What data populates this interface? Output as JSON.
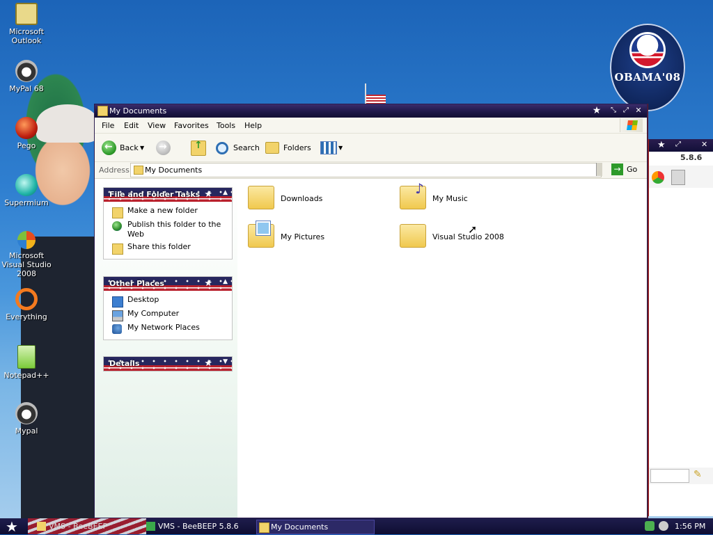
{
  "desktop": {
    "icons": [
      {
        "label": "Microsoft Outlook"
      },
      {
        "label": "MyPal 68"
      },
      {
        "label": "Pego"
      },
      {
        "label": "Supermium"
      },
      {
        "label": "Microsoft Visual Studio 2008"
      },
      {
        "label": "Everything"
      },
      {
        "label": "Notepad++"
      },
      {
        "label": "Mypal"
      }
    ],
    "badge": {
      "text": "OBAMA'08"
    }
  },
  "bg_window": {
    "version": "5.8.6"
  },
  "window": {
    "title": "My Documents",
    "menu": [
      "File",
      "Edit",
      "View",
      "Favorites",
      "Tools",
      "Help"
    ],
    "toolbar": {
      "back": "Back",
      "search": "Search",
      "folders": "Folders"
    },
    "address": {
      "label": "Address",
      "value": "My Documents",
      "go": "Go"
    },
    "tasks": {
      "file_folder": {
        "title": "File and Folder Tasks",
        "items": [
          "Make a new folder",
          "Publish this folder to the Web",
          "Share this folder"
        ]
      },
      "other_places": {
        "title": "Other Places",
        "items": [
          "Desktop",
          "My Computer",
          "My Network Places"
        ]
      },
      "details": {
        "title": "Details"
      }
    },
    "items": [
      {
        "name": "Downloads"
      },
      {
        "name": "My Music"
      },
      {
        "name": "My Pictures"
      },
      {
        "name": "Visual Studio 2008"
      }
    ]
  },
  "taskbar": {
    "tasks": [
      "VMS - BeeBEEP",
      "VMS - BeeBEEP 5.8.6",
      "My Documents"
    ],
    "clock": "1:56 PM"
  },
  "colors": {
    "title_bar": "#1d1746",
    "accent_red": "#b91f2b",
    "panel_link": "#000000"
  }
}
